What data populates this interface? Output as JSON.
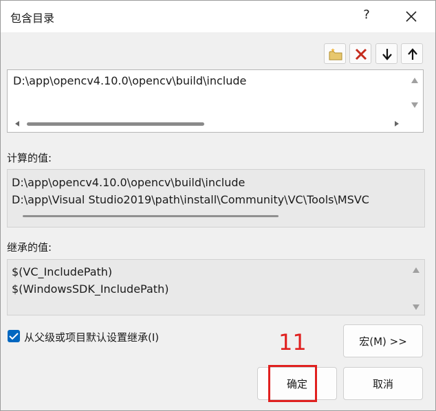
{
  "dialog": {
    "title": "包含目录",
    "help_label": "?"
  },
  "toolbar": {
    "icons": [
      "new-folder-icon",
      "delete-icon",
      "move-down-icon",
      "move-up-icon"
    ]
  },
  "directories": {
    "items": [
      "D:\\app\\opencv4.10.0\\opencv\\build\\include"
    ]
  },
  "evaluated": {
    "label": "计算的值:",
    "lines": [
      "D:\\app\\opencv4.10.0\\opencv\\build\\include",
      "D:\\app\\Visual Studio2019\\path\\install\\Community\\VC\\Tools\\MSVC"
    ]
  },
  "inherited": {
    "label": "继承的值:",
    "lines": [
      "$(VC_IncludePath)",
      "$(WindowsSDK_IncludePath)"
    ]
  },
  "options": {
    "inherit_label": "从父级或项目默认设置继承(I)",
    "inherit_checked": true
  },
  "buttons": {
    "macros": "宏(M) >>",
    "ok": "确定",
    "cancel": "取消"
  },
  "annotation": {
    "step_number": "11",
    "color": "#e0201f"
  }
}
